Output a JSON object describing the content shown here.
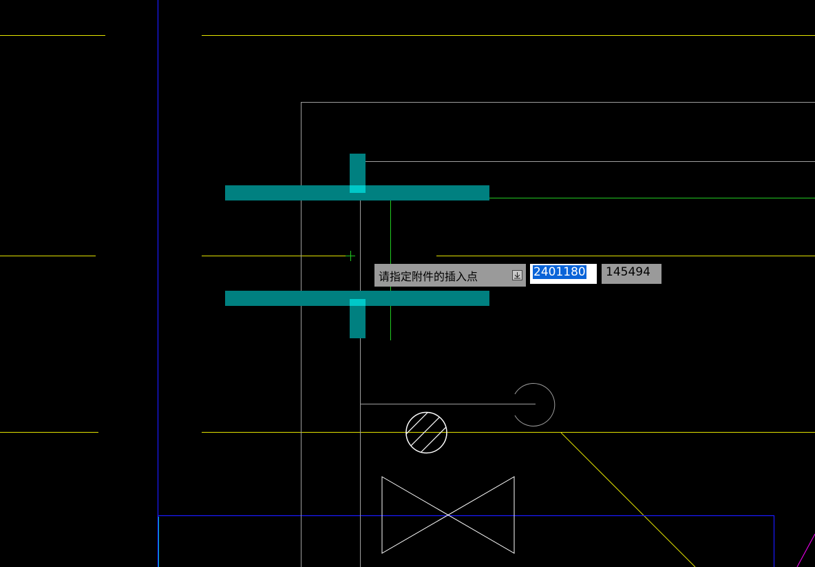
{
  "command_prompt": {
    "label": "请指定附件的插入点",
    "dropdown_icon": "arrow-down-icon"
  },
  "coordinate_input": {
    "x_value": "2401180",
    "y_value": "145494"
  },
  "colors": {
    "background": "#000000",
    "yellow_line": "#e6e600",
    "blue_line": "#1a1aff",
    "gray_line": "#a0a0a0",
    "green_line": "#22cc22",
    "cyan_fill": "#008080",
    "cyan_highlight": "#00c8c8",
    "magenta_line": "#e000e0",
    "white_line": "#ffffff",
    "selection": "#0a64d8"
  }
}
